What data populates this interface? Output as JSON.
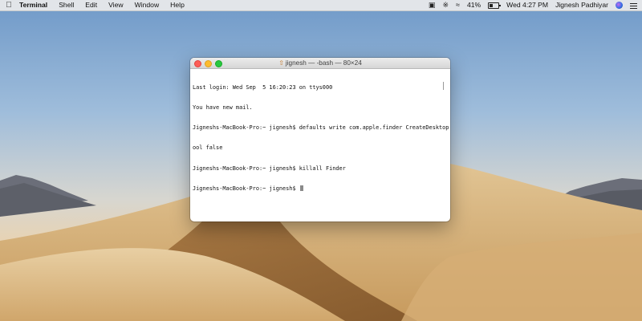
{
  "menubar": {
    "app_name": "Terminal",
    "menus": [
      "Shell",
      "Edit",
      "View",
      "Window",
      "Help"
    ],
    "battery_percent": "41%",
    "datetime": "Wed 4:27 PM",
    "user_name": "Jignesh Padhiyar",
    "status_icons": [
      "photo-icon",
      "bluetooth-icon",
      "wifi-icon",
      "battery-icon",
      "siri-icon",
      "notification-center-icon"
    ]
  },
  "terminal": {
    "title": "jignesh — -bash — 80×24",
    "lines": [
      "Last login: Wed Sep  5 16:20:23 on ttys000",
      "You have new mail.",
      "Jigneshs-MacBook-Pro:~ jignesh$ defaults write com.apple.finder CreateDesktop -b",
      "ool false",
      "Jigneshs-MacBook-Pro:~ jignesh$ killall Finder",
      "Jigneshs-MacBook-Pro:~ jignesh$ "
    ]
  },
  "colors": {
    "close": "#fd5e57",
    "minimize": "#fdbc2e",
    "maximize": "#28c840"
  }
}
